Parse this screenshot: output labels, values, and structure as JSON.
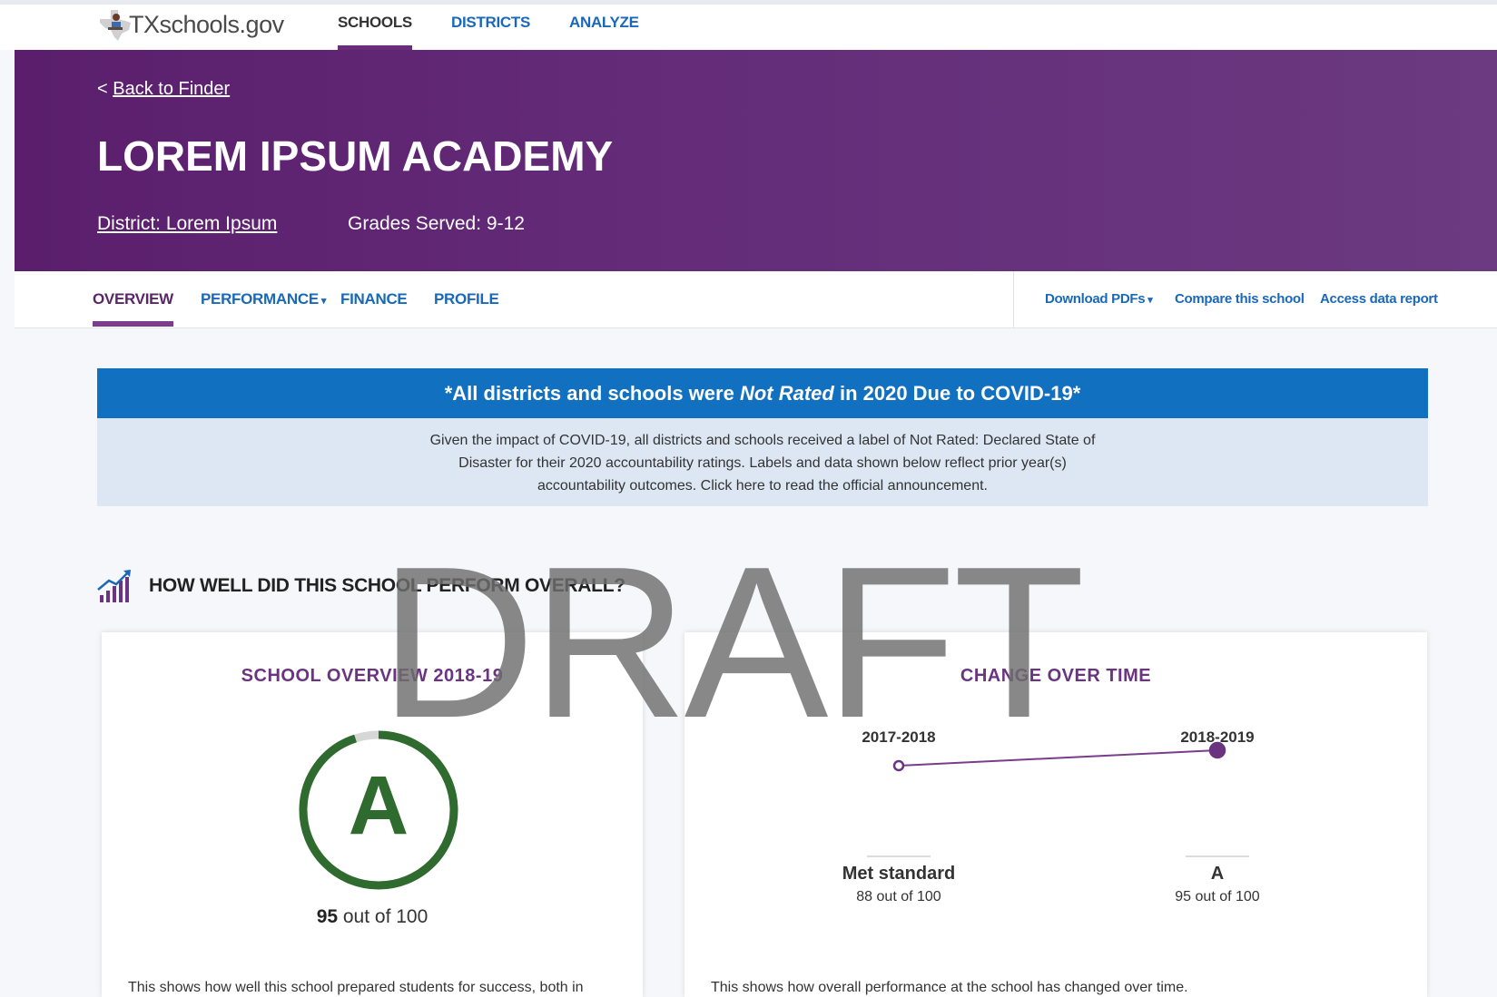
{
  "header": {
    "logo_text": "TXschools.gov",
    "nav": [
      "SCHOOLS",
      "DISTRICTS",
      "ANALYZE"
    ]
  },
  "hero": {
    "back_link": "Back to Finder",
    "back_prefix": "<",
    "school_name": "LOREM IPSUM ACADEMY",
    "district": "District: Lorem Ipsum",
    "grades": "Grades Served: 9-12"
  },
  "subnav": {
    "tabs": [
      "OVERVIEW",
      "PERFORMANCE",
      "FINANCE",
      "PROFILE"
    ],
    "download_pdfs": "Download PDFs",
    "compare": "Compare this school",
    "access_report": "Access data report"
  },
  "covid": {
    "heading_pre": "*All districts and schools were ",
    "heading_em": "Not Rated",
    "heading_post": " in 2020 Due to COVID-19*",
    "body": "Given the impact of COVID-19, all districts and schools received a label of Not Rated: Declared State of Disaster for their 2020 accountability ratings. Labels and data shown below reflect prior year(s) accountability outcomes. Click here to read the  official announcement."
  },
  "section": {
    "title": "HOW WELL DID THIS SCHOOL PERFORM OVERALL?"
  },
  "overview_card": {
    "title": "SCHOOL OVERVIEW 2018-19",
    "grade": "A",
    "score_value": "95",
    "score_suffix": " out of 100",
    "score_fraction": 0.95,
    "description": "This shows how well this school prepared students for success, both in"
  },
  "change_card": {
    "title": "CHANGE OVER TIME",
    "points": [
      {
        "year": "2017-2018",
        "label": "Met standard",
        "score_value": "88",
        "score_suffix": " out of 100",
        "score": 88
      },
      {
        "year": "2018-2019",
        "label": "A",
        "score_value": "95",
        "score_suffix": " out of 100",
        "score": 95
      }
    ],
    "description": "This shows how overall performance at the school has changed over time."
  },
  "watermark": "DRAFT",
  "colors": {
    "brand_purple": "#642c79",
    "link_blue": "#1a68b8",
    "banner_blue": "#1170c0",
    "grade_green": "#2f6a2f"
  }
}
